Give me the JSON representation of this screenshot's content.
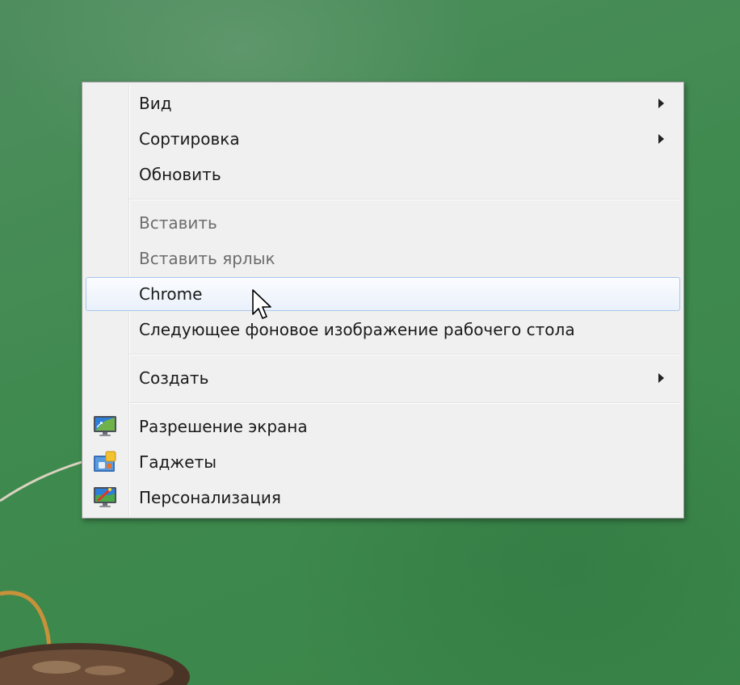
{
  "context_menu": {
    "items": [
      {
        "id": "view",
        "label": "Вид",
        "has_submenu": true,
        "disabled": false
      },
      {
        "id": "sort",
        "label": "Сортировка",
        "has_submenu": true,
        "disabled": false
      },
      {
        "id": "refresh",
        "label": "Обновить",
        "has_submenu": false,
        "disabled": false
      },
      {
        "id": "paste",
        "label": "Вставить",
        "has_submenu": false,
        "disabled": true
      },
      {
        "id": "paste-shortcut",
        "label": "Вставить ярлык",
        "has_submenu": false,
        "disabled": true
      },
      {
        "id": "chrome",
        "label": "Chrome",
        "has_submenu": false,
        "disabled": false,
        "highlighted": true
      },
      {
        "id": "next-wallpaper",
        "label": "Следующее фоновое изображение рабочего стола",
        "has_submenu": false,
        "disabled": false
      },
      {
        "id": "new",
        "label": "Создать",
        "has_submenu": true,
        "disabled": false
      },
      {
        "id": "screen-resolution",
        "label": "Разрешение экрана",
        "has_submenu": false,
        "disabled": false,
        "icon": "screen-resolution-icon"
      },
      {
        "id": "gadgets",
        "label": "Гаджеты",
        "has_submenu": false,
        "disabled": false,
        "icon": "gadgets-icon"
      },
      {
        "id": "personalization",
        "label": "Персонализация",
        "has_submenu": false,
        "disabled": false,
        "icon": "personalization-icon"
      }
    ]
  },
  "colors": {
    "menu_background": "#f0f0f0",
    "hover_border": "#a8c6ea",
    "disabled_text": "#6d6d6d",
    "desktop_green": "#3f8a4f"
  }
}
